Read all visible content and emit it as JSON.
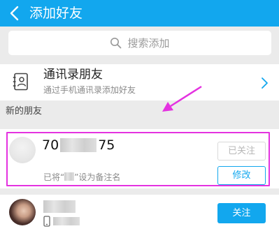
{
  "header": {
    "title": "添加好友"
  },
  "search": {
    "placeholder": "搜索添加"
  },
  "contacts": {
    "title": "通讯录朋友",
    "subtitle": "通过手机通讯录添加好友"
  },
  "section": {
    "new_friends_label": "新的朋友"
  },
  "new_friend": {
    "id_prefix": "70",
    "id_suffix": "75",
    "note_prefix": "已将“",
    "note_suffix": "”设为备注名",
    "followed_label": "已关注",
    "edit_label": "修改"
  },
  "second_friend": {
    "follow_label": "关注"
  },
  "colors": {
    "accent": "#12a7ee",
    "highlight": "#e432e0"
  }
}
